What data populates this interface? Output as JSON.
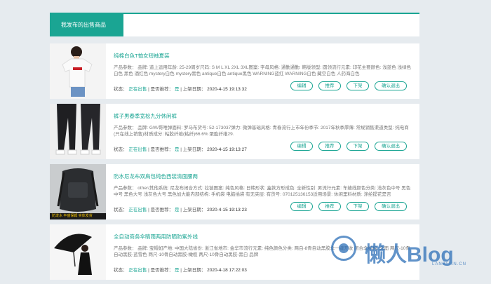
{
  "header": {
    "active_tab": "我发布的出售商品"
  },
  "labels": {
    "status": "状态：",
    "recommend": "是否推荐：",
    "date": "上架日期：",
    "sep": "|",
    "edit": "编辑",
    "recommend_btn": "推荐",
    "offshelf": "下架",
    "confirm_exit": "确认退出"
  },
  "items": [
    {
      "title": "纯棉白色T恤女短袖夏装",
      "params": "产品参数： 品牌: 道上运用年龄: 25-29周岁尺码: S M L XL 2XL 3XL图案: 字母风格: 通勤通勤: 韩版领型: 圆领流行元素: 印花主要颜色: 浅蓝色 浅绿色 白色 黑色 酒红色 mystery白色 mystery黑色 antique白色 antique黑色 WARNING蓝红 WARNING白色 藏空白色 人药海白色",
      "status": "正在出售",
      "recommend": "是",
      "date": "2020-4-15 19:13:32"
    },
    {
      "title": "裤子男春季宽松九分休闲裤",
      "params": "产品参数： 品牌: GW/哥唯弹面料: 罗马布货号: 52-173037弹力: 微弹基础风格: 青春流行上市年份季节: 2017年秋季厚薄: 常规销售渠道类型: 纯电商(只在线上销售)材质成分: 粘胶纤维(粘纤)66.6% 聚酯纤维29.",
      "status": "正在出售",
      "recommend": "是",
      "date": "2020-4-15 19:13:27"
    },
    {
      "title": "防水尼龙布双肩包纯色西装清面腰两",
      "params": "产品参数： other/其他系统: 尼龙布闭合方式: 拉链图案: 纯色风格: 日韩形状: 盒款方形成色: 全新性别: 男流行元素: 车缝线颜色分类: 浅灰色中号 黑色中号 黑色大号 浅灰色大号 黑色加大能内部结构: 手机袋 电脑插袋 有无夹层: 有货号: 070125136153适用场景: 休闲里料材质: 涤纶提花是否",
      "status": "正在出售",
      "recommend": "是",
      "date": "2020-4-15 19:13:23",
      "strip": "防泼水   丰盛保姆  实体发货"
    },
    {
      "title": "全自动商务伞睛雨两用防晒防紫外线",
      "params": "产品参数： 品牌: 宝帽如产地: 中国大陆省份: 浙江省地市: 金华市流行元素: 纯色颜色分类: 两白-8骨自动黑胶伞一键开收 闭合伞结构: 伞面 两尺-10骨自动黑胶-蓝雪色 两尺-10骨自动黑胶-橄榄 两尺-10骨自动黑胶-黑白 品牌",
      "status": "正在出售",
      "recommend": "是",
      "date": "2020-4-18 17:22:03"
    }
  ],
  "watermark": {
    "brand": "懒人Blog",
    "sub": "LANRENN.CN"
  }
}
